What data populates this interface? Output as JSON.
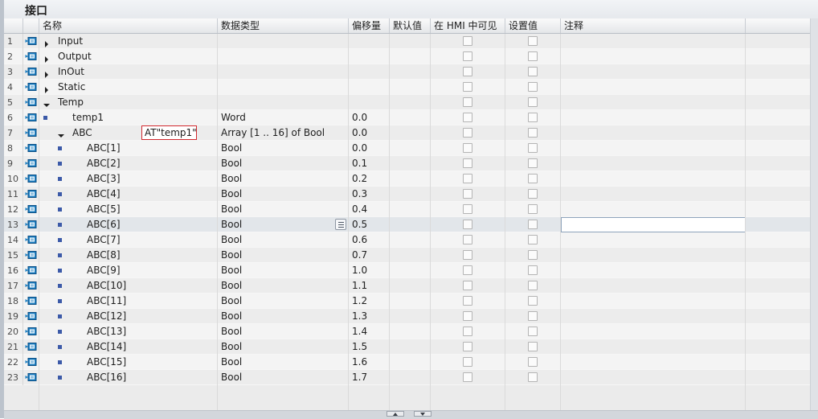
{
  "title": "接口",
  "columns": {
    "name": "名称",
    "datatype": "数据类型",
    "offset": "偏移量",
    "default": "默认值",
    "hmi": "在 HMI 中可见",
    "setpoint": "设置值",
    "comment": "注释"
  },
  "at_value": "AT\"temp1\"",
  "rows": [
    {
      "num": "1",
      "name": "Input",
      "type": "",
      "offset": "",
      "level": 0,
      "node": "collapsed"
    },
    {
      "num": "2",
      "name": "Output",
      "type": "",
      "offset": "",
      "level": 0,
      "node": "collapsed"
    },
    {
      "num": "3",
      "name": "InOut",
      "type": "",
      "offset": "",
      "level": 0,
      "node": "collapsed"
    },
    {
      "num": "4",
      "name": "Static",
      "type": "",
      "offset": "",
      "level": 0,
      "node": "collapsed"
    },
    {
      "num": "5",
      "name": "Temp",
      "type": "",
      "offset": "",
      "level": 0,
      "node": "expanded"
    },
    {
      "num": "6",
      "name": "temp1",
      "type": "Word",
      "offset": "0.0",
      "level": 1,
      "node": "leaf"
    },
    {
      "num": "7",
      "name": "ABC",
      "type": "Array [1 .. 16] of Bool",
      "offset": "0.0",
      "level": 1,
      "node": "expanded"
    },
    {
      "num": "8",
      "name": "ABC[1]",
      "type": "Bool",
      "offset": "0.0",
      "level": 2,
      "node": "leaf"
    },
    {
      "num": "9",
      "name": "ABC[2]",
      "type": "Bool",
      "offset": "0.1",
      "level": 2,
      "node": "leaf"
    },
    {
      "num": "10",
      "name": "ABC[3]",
      "type": "Bool",
      "offset": "0.2",
      "level": 2,
      "node": "leaf"
    },
    {
      "num": "11",
      "name": "ABC[4]",
      "type": "Bool",
      "offset": "0.3",
      "level": 2,
      "node": "leaf"
    },
    {
      "num": "12",
      "name": "ABC[5]",
      "type": "Bool",
      "offset": "0.4",
      "level": 2,
      "node": "leaf"
    },
    {
      "num": "13",
      "name": "ABC[6]",
      "type": "Bool",
      "offset": "0.5",
      "level": 2,
      "node": "leaf"
    },
    {
      "num": "14",
      "name": "ABC[7]",
      "type": "Bool",
      "offset": "0.6",
      "level": 2,
      "node": "leaf"
    },
    {
      "num": "15",
      "name": "ABC[8]",
      "type": "Bool",
      "offset": "0.7",
      "level": 2,
      "node": "leaf"
    },
    {
      "num": "16",
      "name": "ABC[9]",
      "type": "Bool",
      "offset": "1.0",
      "level": 2,
      "node": "leaf"
    },
    {
      "num": "17",
      "name": "ABC[10]",
      "type": "Bool",
      "offset": "1.1",
      "level": 2,
      "node": "leaf"
    },
    {
      "num": "18",
      "name": "ABC[11]",
      "type": "Bool",
      "offset": "1.2",
      "level": 2,
      "node": "leaf"
    },
    {
      "num": "19",
      "name": "ABC[12]",
      "type": "Bool",
      "offset": "1.3",
      "level": 2,
      "node": "leaf"
    },
    {
      "num": "20",
      "name": "ABC[13]",
      "type": "Bool",
      "offset": "1.4",
      "level": 2,
      "node": "leaf"
    },
    {
      "num": "21",
      "name": "ABC[14]",
      "type": "Bool",
      "offset": "1.5",
      "level": 2,
      "node": "leaf"
    },
    {
      "num": "22",
      "name": "ABC[15]",
      "type": "Bool",
      "offset": "1.6",
      "level": 2,
      "node": "leaf"
    },
    {
      "num": "23",
      "name": "ABC[16]",
      "type": "Bool",
      "offset": "1.7",
      "level": 2,
      "node": "leaf"
    }
  ],
  "icons": {
    "row": "interface-param-icon",
    "expanded": "triangle-down-icon",
    "collapsed": "triangle-right-icon",
    "leaf": "element-dot-icon",
    "list": "list-icon"
  },
  "colors": {
    "accent": "#3c5aa8",
    "at_border": "#d0282e",
    "edit_border": "#8ea3bb"
  }
}
